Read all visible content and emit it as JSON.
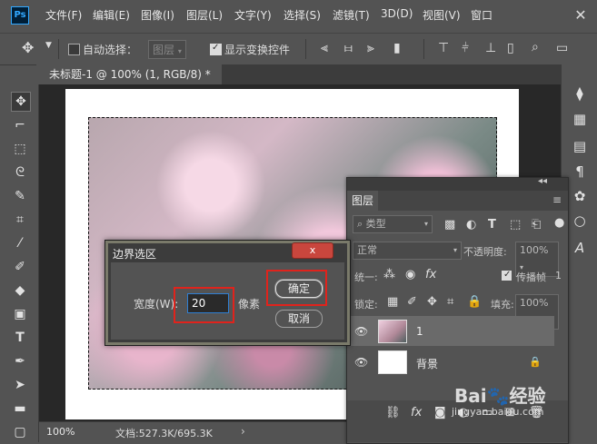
{
  "app": {
    "logo": "Ps",
    "menu": [
      "文件(F)",
      "编辑(E)",
      "图像(I)",
      "图层(L)",
      "文字(Y)",
      "选择(S)",
      "滤镜(T)",
      "3D(D)",
      "视图(V)",
      "窗口"
    ],
    "close_glyph": "✕"
  },
  "options_bar": {
    "auto_select_label": "自动选择：",
    "auto_select_checked": false,
    "auto_select_target": "图层",
    "show_transform_label": "显示变换控件",
    "show_transform_checked": true
  },
  "document": {
    "tab_title": "未标题-1 @ 100% (1, RGB/8) *",
    "tab_close": "×"
  },
  "status": {
    "zoom": "100%",
    "doc_size": "文档:527.3K/695.3K",
    "arrow": "›"
  },
  "layers_panel": {
    "title": "图层",
    "filter_kind": "类型",
    "blend_mode": "正常",
    "opacity_label": "不透明度:",
    "opacity_value": "100%",
    "unify_label": "统一:",
    "propagate_label": "传播帧",
    "propagate_value": "1",
    "lock_label": "锁定:",
    "fill_label": "填充:",
    "fill_value": "100%",
    "layers": [
      {
        "name": "1",
        "visible": true,
        "selected": true
      },
      {
        "name": "背景",
        "visible": true,
        "selected": false,
        "locked": true
      }
    ]
  },
  "dialog": {
    "title": "边界选区",
    "close_glyph": "x",
    "width_label": "宽度(W):",
    "width_value": "20",
    "unit_label": "像素",
    "ok_label": "确定",
    "cancel_label": "取消",
    "highlight_color": "#e0231c"
  },
  "watermark": {
    "main": "Bai🐾经验",
    "sub": "jingyan.baidu.com"
  }
}
